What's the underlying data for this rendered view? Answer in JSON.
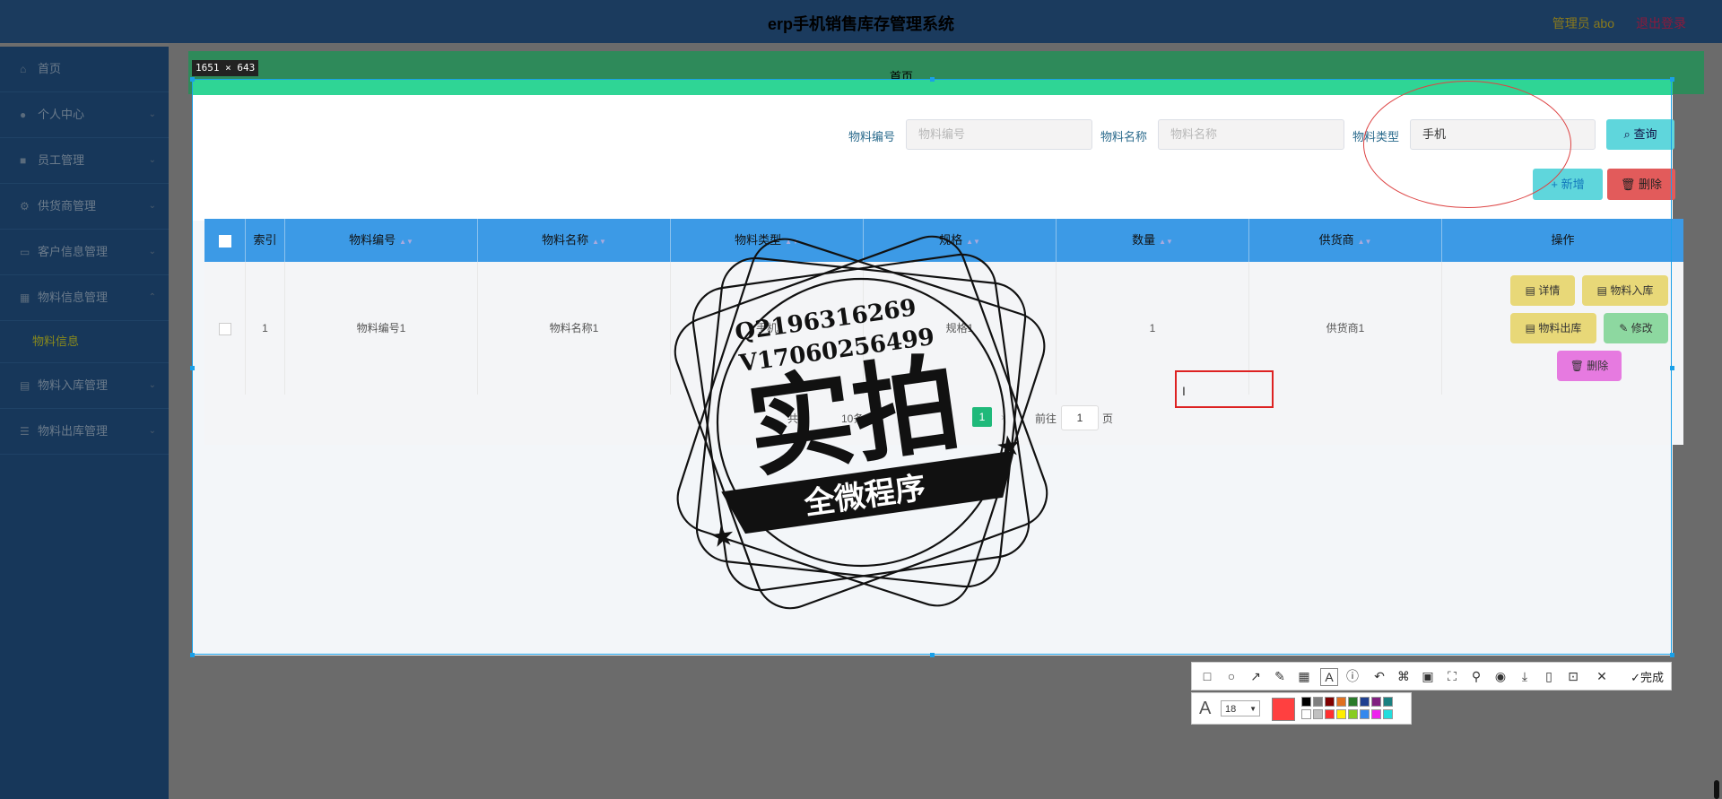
{
  "header": {
    "title": "erp手机销售库存管理系统",
    "user_label": "管理员 abo",
    "logout_label": "退出登录"
  },
  "sidebar": {
    "items": [
      {
        "label": "首页",
        "icon": "home-icon"
      },
      {
        "label": "个人中心",
        "icon": "user-icon"
      },
      {
        "label": "员工管理",
        "icon": "briefcase-icon"
      },
      {
        "label": "供货商管理",
        "icon": "gear-icon"
      },
      {
        "label": "客户信息管理",
        "icon": "card-icon"
      },
      {
        "label": "物料信息管理",
        "icon": "box-icon"
      },
      {
        "label": "物料信息",
        "icon": ""
      },
      {
        "label": "物料入库管理",
        "icon": "document-icon"
      },
      {
        "label": "物料出库管理",
        "icon": "list-icon"
      }
    ]
  },
  "tabbar": {
    "active_tab": "首页"
  },
  "screenshot_overlay": {
    "dimensions_label": "1651 × 643",
    "done_label": "完成",
    "font_size_value": "18",
    "pen_color": "#ff4040"
  },
  "search": {
    "code_label": "物料编号",
    "code_placeholder": "物料编号",
    "name_label": "物料名称",
    "name_placeholder": "物料名称",
    "type_label": "物料类型",
    "type_value": "手机",
    "query_label": "查询"
  },
  "actions": {
    "add_label": "+ 新增",
    "delete_label": "删除"
  },
  "table": {
    "headers": [
      "索引",
      "物料编号",
      "物料名称",
      "物料类型",
      "规格",
      "数量",
      "供货商",
      "操作"
    ],
    "rows": [
      {
        "index": "1",
        "code": "物料编号1",
        "name": "物料名称1",
        "type": "手机",
        "spec": "规格1",
        "qty": "1",
        "supplier": "供货商1"
      }
    ],
    "row_actions": {
      "detail": "详情",
      "inbound": "物料入库",
      "outbound": "物料出库",
      "edit": "修改",
      "delete": "删除"
    }
  },
  "pager": {
    "total_prefix": "共",
    "page_size": "10条/页",
    "goto_label": "前往",
    "goto_value": "1",
    "page_unit": "页",
    "current_page": "1"
  },
  "watermark": {
    "line1": "Q2196316269",
    "line2": "V17060256499",
    "big_text": "实拍",
    "banner_text": "全微程序"
  },
  "colors": {
    "header_bg": "#1b3b5e",
    "sidebar_bg": "#17375a",
    "table_header": "#3c9ae6",
    "query_btn": "#5fd6dc",
    "delete_btn": "#e25b5b",
    "tab_strip": "#2fd595"
  }
}
